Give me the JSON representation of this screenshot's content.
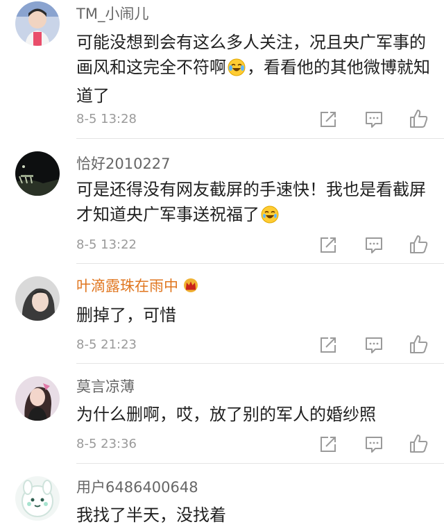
{
  "comments": [
    {
      "username": "TM_小闹儿",
      "text_before_emoji": "可能没想到会有这么多人关注，况且央广军事的画风和这完全不符啊",
      "emoji_name": "crying-laughing-emoji",
      "text_after_emoji": "，看看他的其他微博就知道了",
      "time": "8-5 13:28"
    },
    {
      "username": "恰好2010227",
      "text_before_emoji": "可是还得没有网友截屏的手速快！我也是看截屏才知道央广军事送祝福了",
      "emoji_name": "laughing-emoji",
      "text_after_emoji": "",
      "time": "8-5 13:22"
    },
    {
      "username": "叶滴露珠在雨中",
      "badge": "crown-icon",
      "text": "删掉了，可惜",
      "time": "8-5 21:23"
    },
    {
      "username": "莫言凉薄",
      "text": "为什么删啊，哎，放了别的军人的婚纱照",
      "time": "8-5 23:36"
    },
    {
      "username": "用户6486400648",
      "text": "我找了半天，没找着"
    }
  ],
  "icons": {
    "share": "share-icon",
    "reply": "comment-icon",
    "like": "thumbs-up-icon"
  },
  "colors": {
    "username": "#666666",
    "vip_username": "#e0761f",
    "text": "#1f1f1f",
    "meta": "#9a9a9a",
    "divider": "#e4e4e4"
  }
}
